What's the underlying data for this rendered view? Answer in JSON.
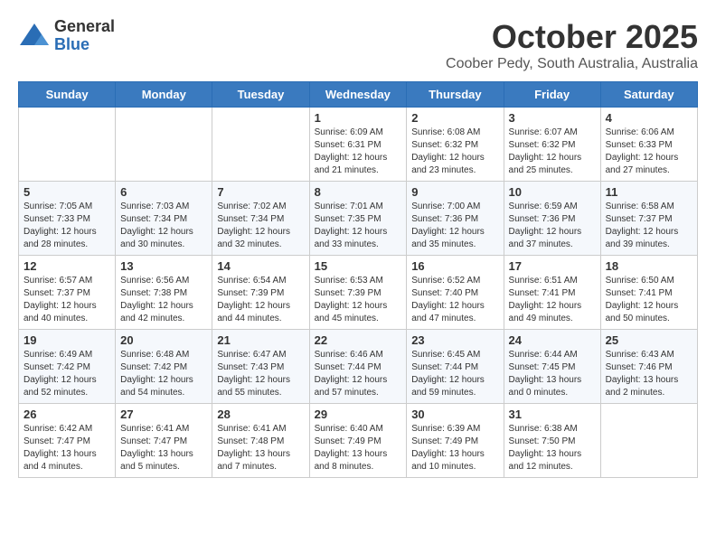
{
  "logo": {
    "general": "General",
    "blue": "Blue"
  },
  "header": {
    "month": "October 2025",
    "location": "Coober Pedy, South Australia, Australia"
  },
  "weekdays": [
    "Sunday",
    "Monday",
    "Tuesday",
    "Wednesday",
    "Thursday",
    "Friday",
    "Saturday"
  ],
  "weeks": [
    [
      {
        "day": "",
        "info": ""
      },
      {
        "day": "",
        "info": ""
      },
      {
        "day": "",
        "info": ""
      },
      {
        "day": "1",
        "info": "Sunrise: 6:09 AM\nSunset: 6:31 PM\nDaylight: 12 hours\nand 21 minutes."
      },
      {
        "day": "2",
        "info": "Sunrise: 6:08 AM\nSunset: 6:32 PM\nDaylight: 12 hours\nand 23 minutes."
      },
      {
        "day": "3",
        "info": "Sunrise: 6:07 AM\nSunset: 6:32 PM\nDaylight: 12 hours\nand 25 minutes."
      },
      {
        "day": "4",
        "info": "Sunrise: 6:06 AM\nSunset: 6:33 PM\nDaylight: 12 hours\nand 27 minutes."
      }
    ],
    [
      {
        "day": "5",
        "info": "Sunrise: 7:05 AM\nSunset: 7:33 PM\nDaylight: 12 hours\nand 28 minutes."
      },
      {
        "day": "6",
        "info": "Sunrise: 7:03 AM\nSunset: 7:34 PM\nDaylight: 12 hours\nand 30 minutes."
      },
      {
        "day": "7",
        "info": "Sunrise: 7:02 AM\nSunset: 7:34 PM\nDaylight: 12 hours\nand 32 minutes."
      },
      {
        "day": "8",
        "info": "Sunrise: 7:01 AM\nSunset: 7:35 PM\nDaylight: 12 hours\nand 33 minutes."
      },
      {
        "day": "9",
        "info": "Sunrise: 7:00 AM\nSunset: 7:36 PM\nDaylight: 12 hours\nand 35 minutes."
      },
      {
        "day": "10",
        "info": "Sunrise: 6:59 AM\nSunset: 7:36 PM\nDaylight: 12 hours\nand 37 minutes."
      },
      {
        "day": "11",
        "info": "Sunrise: 6:58 AM\nSunset: 7:37 PM\nDaylight: 12 hours\nand 39 minutes."
      }
    ],
    [
      {
        "day": "12",
        "info": "Sunrise: 6:57 AM\nSunset: 7:37 PM\nDaylight: 12 hours\nand 40 minutes."
      },
      {
        "day": "13",
        "info": "Sunrise: 6:56 AM\nSunset: 7:38 PM\nDaylight: 12 hours\nand 42 minutes."
      },
      {
        "day": "14",
        "info": "Sunrise: 6:54 AM\nSunset: 7:39 PM\nDaylight: 12 hours\nand 44 minutes."
      },
      {
        "day": "15",
        "info": "Sunrise: 6:53 AM\nSunset: 7:39 PM\nDaylight: 12 hours\nand 45 minutes."
      },
      {
        "day": "16",
        "info": "Sunrise: 6:52 AM\nSunset: 7:40 PM\nDaylight: 12 hours\nand 47 minutes."
      },
      {
        "day": "17",
        "info": "Sunrise: 6:51 AM\nSunset: 7:41 PM\nDaylight: 12 hours\nand 49 minutes."
      },
      {
        "day": "18",
        "info": "Sunrise: 6:50 AM\nSunset: 7:41 PM\nDaylight: 12 hours\nand 50 minutes."
      }
    ],
    [
      {
        "day": "19",
        "info": "Sunrise: 6:49 AM\nSunset: 7:42 PM\nDaylight: 12 hours\nand 52 minutes."
      },
      {
        "day": "20",
        "info": "Sunrise: 6:48 AM\nSunset: 7:42 PM\nDaylight: 12 hours\nand 54 minutes."
      },
      {
        "day": "21",
        "info": "Sunrise: 6:47 AM\nSunset: 7:43 PM\nDaylight: 12 hours\nand 55 minutes."
      },
      {
        "day": "22",
        "info": "Sunrise: 6:46 AM\nSunset: 7:44 PM\nDaylight: 12 hours\nand 57 minutes."
      },
      {
        "day": "23",
        "info": "Sunrise: 6:45 AM\nSunset: 7:44 PM\nDaylight: 12 hours\nand 59 minutes."
      },
      {
        "day": "24",
        "info": "Sunrise: 6:44 AM\nSunset: 7:45 PM\nDaylight: 13 hours\nand 0 minutes."
      },
      {
        "day": "25",
        "info": "Sunrise: 6:43 AM\nSunset: 7:46 PM\nDaylight: 13 hours\nand 2 minutes."
      }
    ],
    [
      {
        "day": "26",
        "info": "Sunrise: 6:42 AM\nSunset: 7:47 PM\nDaylight: 13 hours\nand 4 minutes."
      },
      {
        "day": "27",
        "info": "Sunrise: 6:41 AM\nSunset: 7:47 PM\nDaylight: 13 hours\nand 5 minutes."
      },
      {
        "day": "28",
        "info": "Sunrise: 6:41 AM\nSunset: 7:48 PM\nDaylight: 13 hours\nand 7 minutes."
      },
      {
        "day": "29",
        "info": "Sunrise: 6:40 AM\nSunset: 7:49 PM\nDaylight: 13 hours\nand 8 minutes."
      },
      {
        "day": "30",
        "info": "Sunrise: 6:39 AM\nSunset: 7:49 PM\nDaylight: 13 hours\nand 10 minutes."
      },
      {
        "day": "31",
        "info": "Sunrise: 6:38 AM\nSunset: 7:50 PM\nDaylight: 13 hours\nand 12 minutes."
      },
      {
        "day": "",
        "info": ""
      }
    ]
  ]
}
